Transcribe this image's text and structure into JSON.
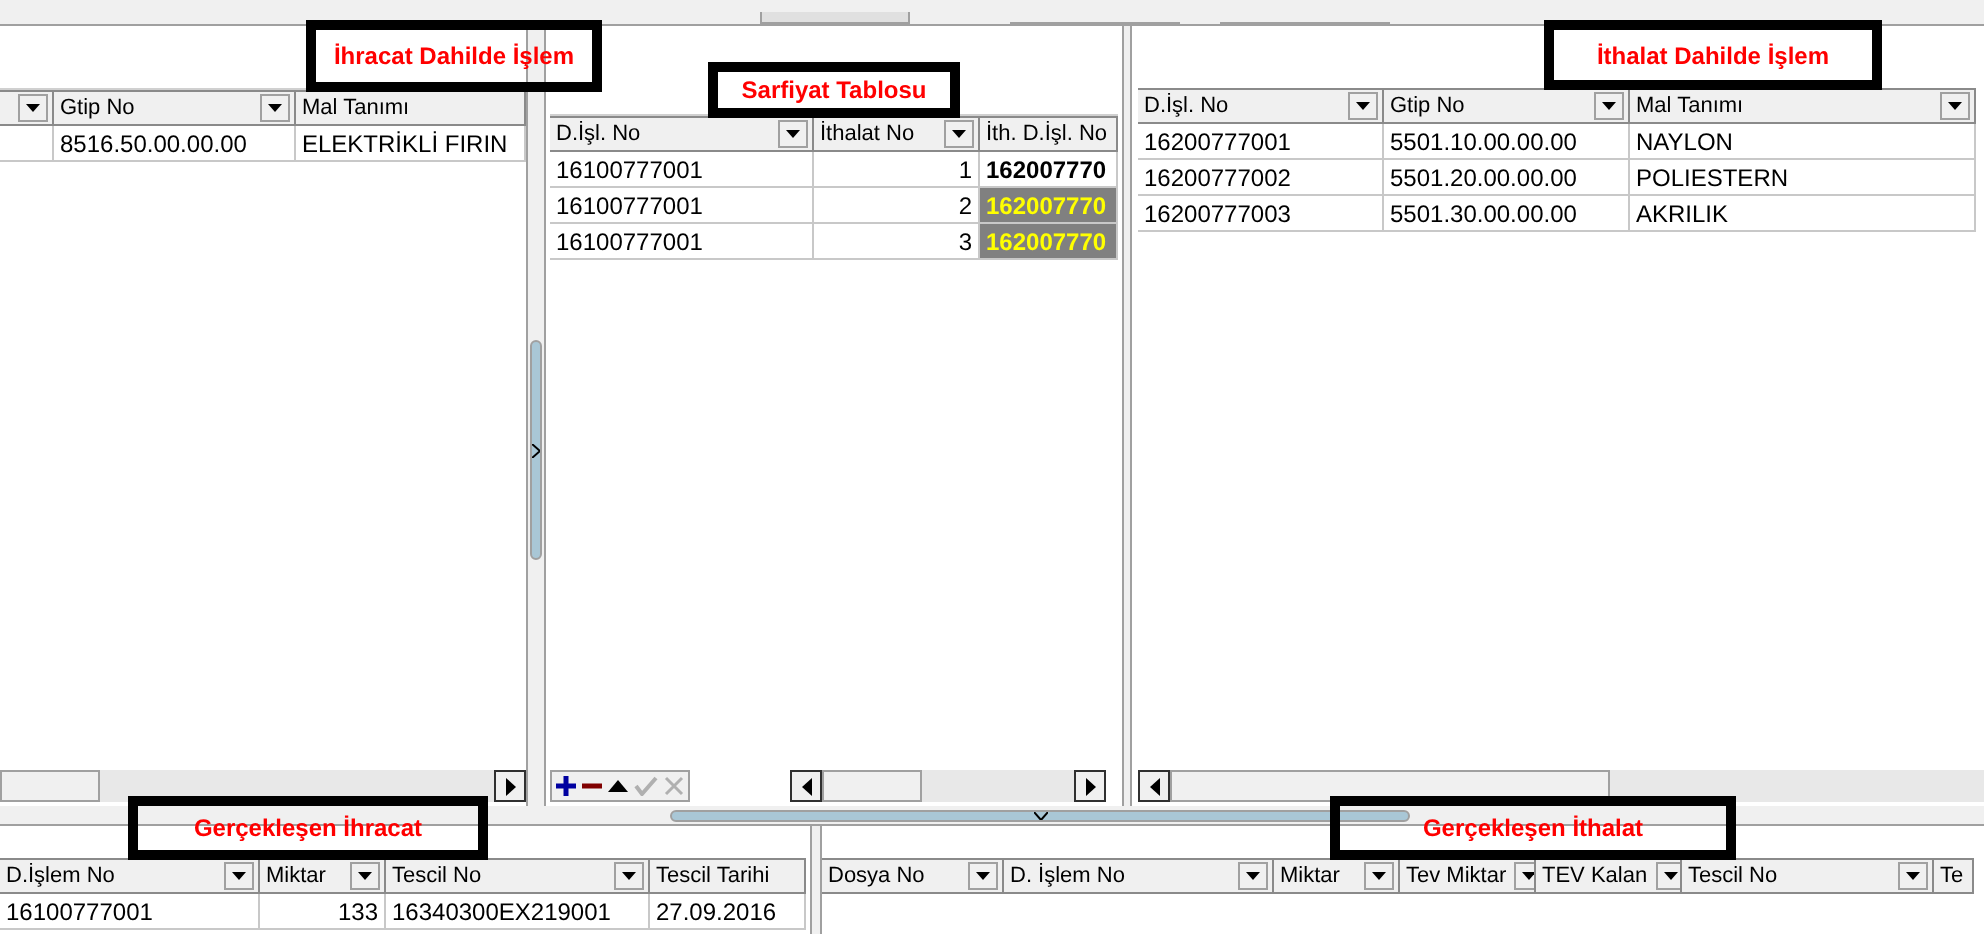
{
  "export_panel": {
    "annotation": "İhracat Dahilde İşlem",
    "columns": [
      {
        "filter": true
      },
      {
        "label": "Gtip No",
        "filter": true
      },
      {
        "label": "Mal Tanımı",
        "filter": false
      }
    ],
    "rows": [
      {
        "cells": [
          "",
          "8516.50.00.00.00",
          "ELEKTRİKLİ FIRIN"
        ]
      }
    ]
  },
  "consumption_panel": {
    "annotation": "Sarfiyat Tablosu",
    "columns": [
      {
        "label": "D.İşl. No",
        "filter": true
      },
      {
        "label": "İthalat No",
        "filter": true
      },
      {
        "label": "İth. D.İşl. No"
      }
    ],
    "rows": [
      {
        "cells": [
          "16100777001",
          "1",
          "162007770"
        ],
        "highlighted": false
      },
      {
        "cells": [
          "16100777001",
          "2",
          "162007770"
        ],
        "highlighted": true
      },
      {
        "cells": [
          "16100777001",
          "3",
          "162007770"
        ],
        "highlighted": true
      }
    ]
  },
  "import_panel": {
    "annotation": "İthalat Dahilde İşlem",
    "columns": [
      {
        "label": "D.İşl. No",
        "filter": true
      },
      {
        "label": "Gtip No",
        "filter": true
      },
      {
        "label": "Mal Tanımı",
        "filter": true
      }
    ],
    "rows": [
      {
        "cells": [
          "16200777001",
          "5501.10.00.00.00",
          "NAYLON"
        ]
      },
      {
        "cells": [
          "16200777002",
          "5501.20.00.00.00",
          "POLIESTERN"
        ]
      },
      {
        "cells": [
          "16200777003",
          "5501.30.00.00.00",
          "AKRILIK"
        ]
      }
    ]
  },
  "realized_export": {
    "annotation": "Gerçekleşen İhracat",
    "columns": [
      {
        "label": "D.İşlem No",
        "filter": true
      },
      {
        "label": "Miktar",
        "filter": true
      },
      {
        "label": "Tescil No",
        "filter": true
      },
      {
        "label": "Tescil Tarihi",
        "filter": false
      }
    ],
    "rows": [
      {
        "cells": [
          "16100777001",
          "133",
          "16340300EX219001",
          "27.09.2016"
        ]
      }
    ]
  },
  "realized_import": {
    "annotation": "Gerçekleşen İthalat",
    "columns": [
      {
        "label": "Dosya No",
        "filter": true
      },
      {
        "label": "D. İşlem No",
        "filter": true
      },
      {
        "label": "Miktar",
        "filter": true
      },
      {
        "label": "Tev Miktar",
        "filter": true
      },
      {
        "label": "TEV Kalan",
        "filter": true
      },
      {
        "label": "Tescil No",
        "filter": true
      },
      {
        "label": "Te"
      }
    ]
  }
}
